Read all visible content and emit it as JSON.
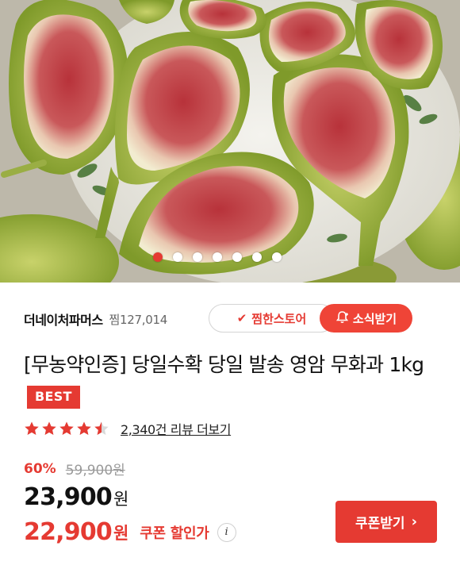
{
  "product_image": {
    "description_icon": "fig-photo",
    "carousel": {
      "total": 7,
      "active_index": 0
    }
  },
  "seller": {
    "name": "더네이처파머스",
    "zzim_count": "찜127,014",
    "fav_store_label": "찜한스토어",
    "news_label": "소식받기"
  },
  "product": {
    "title": "[무농약인증] 당일수확 당일 발송 영암 무화과 1kg",
    "badge": "BEST"
  },
  "rating": {
    "stars": 4.5,
    "review_link": "2,340건 리뷰 더보기"
  },
  "price": {
    "discount_rate": "60%",
    "original_price": "59,900원",
    "sale_price": "23,900",
    "sale_currency": "원",
    "coupon_price": "22,900",
    "coupon_currency": "원",
    "coupon_label": "쿠폰 할인가",
    "info_icon": "i"
  },
  "coupon_button": {
    "label": "쿠폰받기",
    "chevron": "›"
  },
  "colors": {
    "accent": "#e53a32",
    "star": "#e53a32"
  }
}
